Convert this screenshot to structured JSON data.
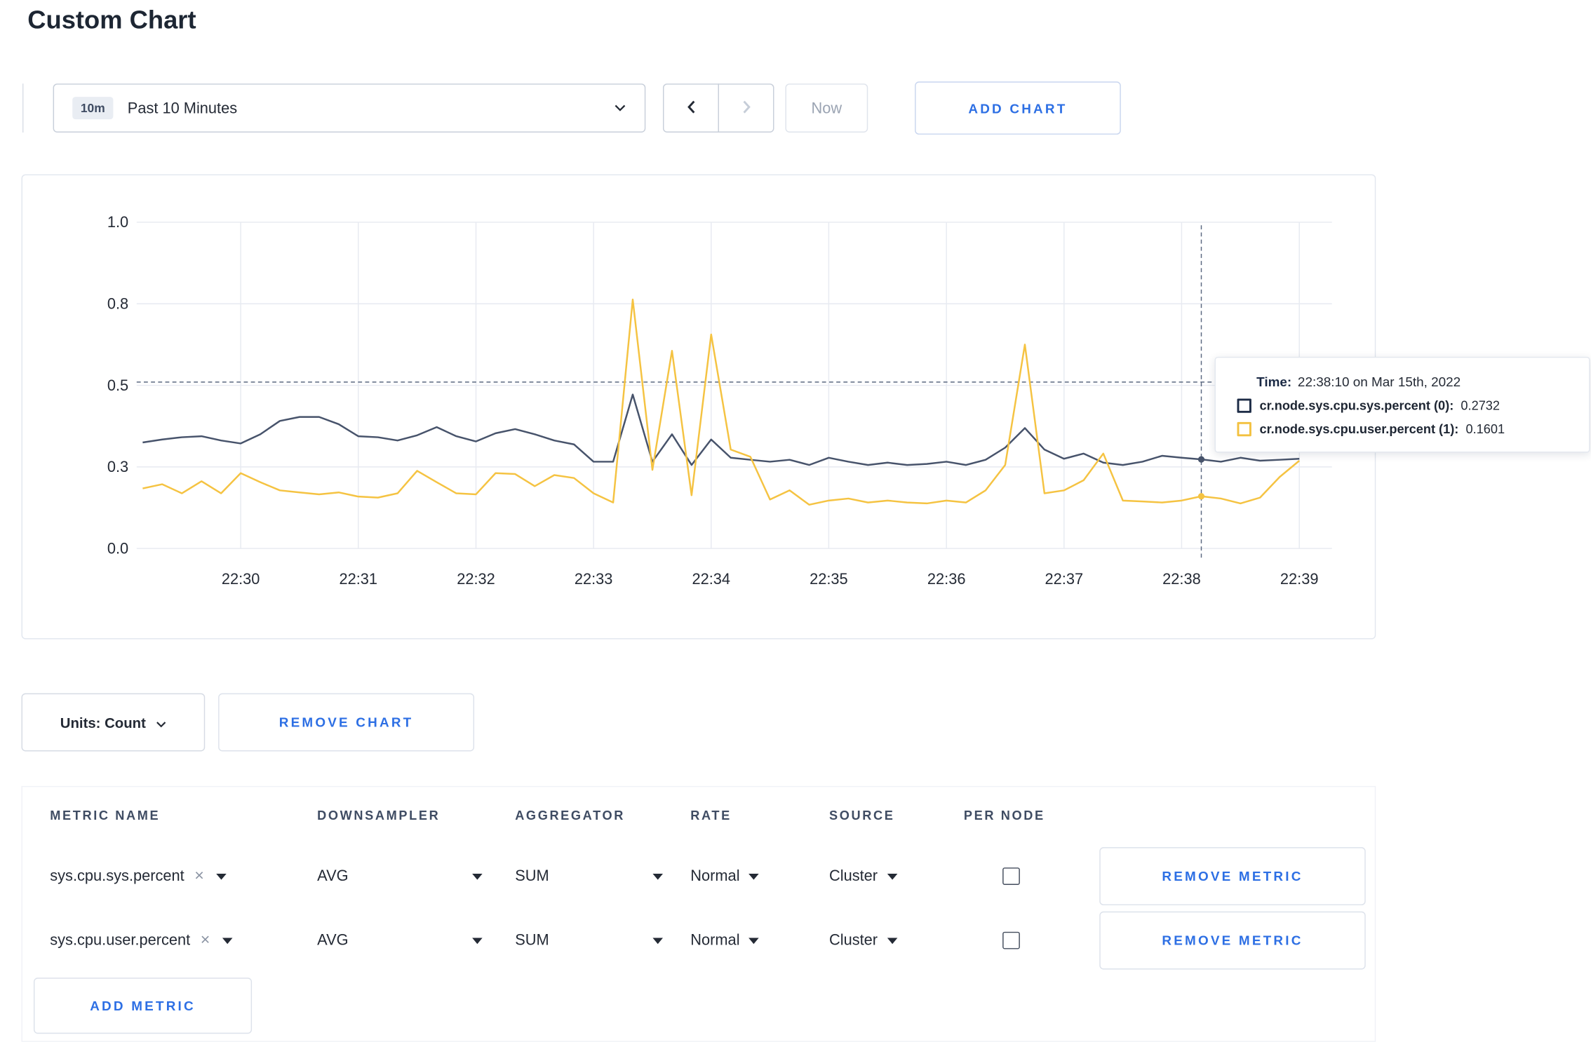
{
  "page": {
    "title": "Custom Chart"
  },
  "toolbar": {
    "time_badge": "10m",
    "time_label": "Past 10 Minutes",
    "now_label": "Now",
    "add_chart_label": "ADD CHART"
  },
  "chart_data": {
    "type": "line",
    "x_ticks": [
      "22:30",
      "22:31",
      "22:32",
      "22:33",
      "22:34",
      "22:35",
      "22:36",
      "22:37",
      "22:38",
      "22:39"
    ],
    "x_start_time": "22:29:10",
    "interval_seconds": 10,
    "y_axis": {
      "labels": [
        "0.0",
        "0.3",
        "0.5",
        "0.8",
        "1.0"
      ],
      "positions": [
        0,
        0.25,
        0.5,
        0.75,
        1.0
      ],
      "range": [
        0,
        1
      ]
    },
    "grid": true,
    "crosshair": {
      "time": "22:38:10",
      "time_seconds": 540,
      "value_line": 0.51
    },
    "series": [
      {
        "name": "cr.node.sys.cpu.sys.percent (0)",
        "color": "#47536b",
        "values": [
          0.325,
          0.334,
          0.341,
          0.344,
          0.331,
          0.322,
          0.35,
          0.391,
          0.403,
          0.403,
          0.381,
          0.344,
          0.341,
          0.331,
          0.347,
          0.372,
          0.344,
          0.328,
          0.353,
          0.366,
          0.35,
          0.331,
          0.319,
          0.266,
          0.266,
          0.472,
          0.266,
          0.35,
          0.256,
          0.334,
          0.278,
          0.272,
          0.266,
          0.272,
          0.256,
          0.278,
          0.266,
          0.256,
          0.263,
          0.256,
          0.259,
          0.266,
          0.256,
          0.272,
          0.309,
          0.369,
          0.303,
          0.275,
          0.291,
          0.263,
          0.256,
          0.266,
          0.284,
          0.278,
          0.2732,
          0.266,
          0.278,
          0.269,
          0.272,
          0.275
        ]
      },
      {
        "name": "cr.node.sys.cpu.user.percent (1)",
        "color": "#f5c342",
        "values": [
          0.184,
          0.197,
          0.169,
          0.206,
          0.169,
          0.231,
          0.203,
          0.178,
          0.172,
          0.166,
          0.172,
          0.159,
          0.156,
          0.169,
          0.238,
          0.203,
          0.169,
          0.166,
          0.231,
          0.228,
          0.191,
          0.225,
          0.216,
          0.169,
          0.141,
          0.763,
          0.241,
          0.606,
          0.163,
          0.656,
          0.303,
          0.281,
          0.15,
          0.178,
          0.134,
          0.147,
          0.153,
          0.141,
          0.147,
          0.141,
          0.138,
          0.147,
          0.141,
          0.178,
          0.256,
          0.625,
          0.169,
          0.178,
          0.209,
          0.291,
          0.147,
          0.144,
          0.141,
          0.147,
          0.1601,
          0.153,
          0.138,
          0.156,
          0.219,
          0.269
        ]
      }
    ]
  },
  "tooltip": {
    "time_label": "Time:",
    "time_value": "22:38:10 on Mar 15th, 2022",
    "series": [
      {
        "label": "cr.node.sys.cpu.sys.percent (0):",
        "value": "0.2732",
        "color": "#1c2b46"
      },
      {
        "label": "cr.node.sys.cpu.user.percent (1):",
        "value": "0.1601",
        "color": "#f3c13f"
      }
    ]
  },
  "chart_footer": {
    "units_label": "Units: Count",
    "remove_chart_label": "REMOVE CHART"
  },
  "metrics_table": {
    "headers": [
      "METRIC NAME",
      "DOWNSAMPLER",
      "AGGREGATOR",
      "RATE",
      "SOURCE",
      "PER NODE"
    ],
    "rows": [
      {
        "metric": "sys.cpu.sys.percent",
        "downsampler": "AVG",
        "aggregator": "SUM",
        "rate": "Normal",
        "source": "Cluster",
        "per_node": false,
        "remove_label": "REMOVE METRIC"
      },
      {
        "metric": "sys.cpu.user.percent",
        "downsampler": "AVG",
        "aggregator": "SUM",
        "rate": "Normal",
        "source": "Cluster",
        "per_node": false,
        "remove_label": "REMOVE METRIC"
      }
    ],
    "add_metric_label": "ADD METRIC"
  },
  "colors": {
    "accent_blue": "#2d6fe4",
    "series_sys": "#47536b",
    "series_user": "#f5c342"
  }
}
